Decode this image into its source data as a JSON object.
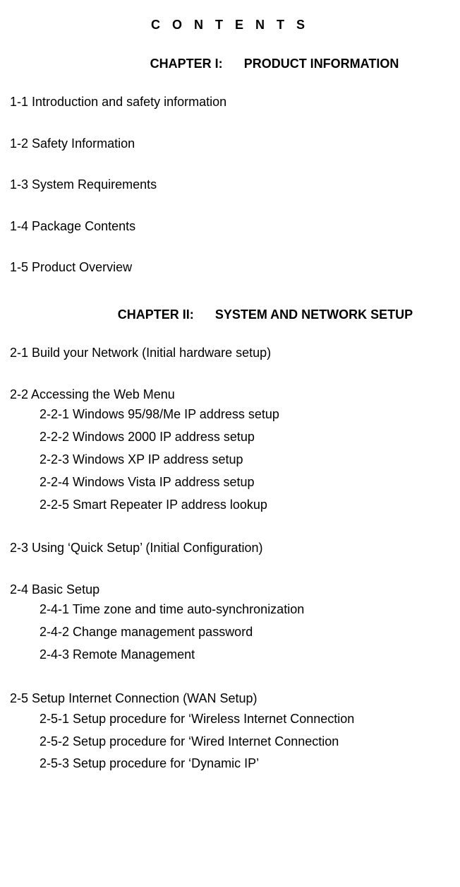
{
  "title": "C O N T E N T S",
  "chapters": [
    {
      "label": "CHAPTER I:",
      "name": "PRODUCT INFORMATION",
      "sections": [
        {
          "num": "1-1",
          "title": "Introduction and safety information"
        },
        {
          "num": "1-2",
          "title": "Safety Information"
        },
        {
          "num": "1-3",
          "title": "System Requirements"
        },
        {
          "num": "1-4",
          "title": "Package Contents"
        },
        {
          "num": "1-5",
          "title": "Product Overview"
        }
      ]
    },
    {
      "label": "CHAPTER II:",
      "name": "SYSTEM AND NETWORK SETUP",
      "sections": [
        {
          "num": "2-1",
          "title": "Build your Network (Initial hardware setup)"
        },
        {
          "num": "2-2",
          "title": "Accessing the Web Menu",
          "subs": [
            {
              "num": "2-2-1",
              "title": "Windows 95/98/Me IP address setup"
            },
            {
              "num": "2-2-2",
              "title": "Windows 2000 IP address setup"
            },
            {
              "num": "2-2-3",
              "title": "Windows XP IP address setup"
            },
            {
              "num": "2-2-4",
              "title": "Windows Vista IP address setup"
            },
            {
              "num": "2-2-5",
              "title": "Smart Repeater IP address lookup"
            }
          ]
        },
        {
          "num": "2-3",
          "title": "Using ‘Quick Setup’ (Initial Configuration)"
        },
        {
          "num": "2-4",
          "title": "Basic Setup",
          "subs": [
            {
              "num": "2-4-1",
              "title": "Time zone and time auto-synchronization"
            },
            {
              "num": "2-4-2",
              "title": "Change management password"
            },
            {
              "num": "2-4-3",
              "title": "Remote Management"
            }
          ]
        },
        {
          "num": "2-5",
          "title": "Setup Internet Connection (WAN Setup)",
          "subs": [
            {
              "num": "2-5-1",
              "title": "Setup procedure for ‘Wireless Internet Connection"
            },
            {
              "num": "2-5-2",
              "title": "Setup procedure for ‘Wired Internet Connection"
            },
            {
              "num": "2-5-3",
              "title": "Setup procedure for ‘Dynamic IP’"
            }
          ]
        }
      ]
    }
  ]
}
